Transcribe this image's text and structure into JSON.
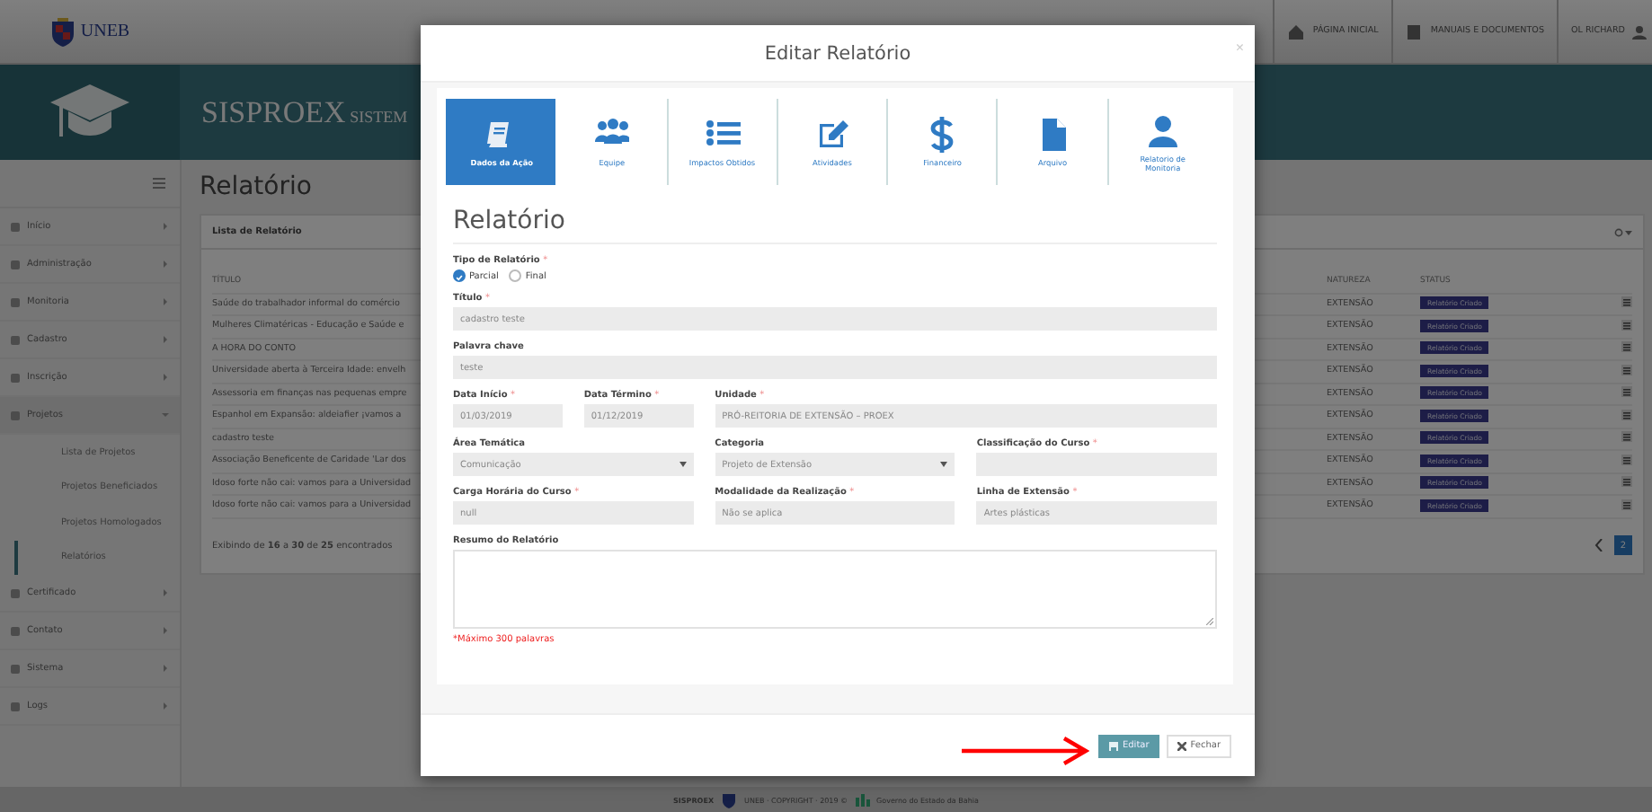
{
  "header": {
    "logo": "UNEB",
    "links": [
      {
        "kind": "home",
        "label": "PÁGINA INICIAL"
      },
      {
        "kind": "docs",
        "label": "MANUAIS E DOCUMENTOS"
      }
    ],
    "user": "OL RICHARD"
  },
  "banner": {
    "title": "SISPROEX",
    "subtitle": "SISTEM"
  },
  "sidebar": {
    "items": [
      {
        "label": "Início",
        "expanded": false
      },
      {
        "label": "Administração",
        "expanded": false
      },
      {
        "label": "Monitoria",
        "expanded": false
      },
      {
        "label": "Cadastro",
        "expanded": false
      },
      {
        "label": "Inscrição",
        "expanded": false
      },
      {
        "label": "Projetos",
        "expanded": true,
        "children": [
          {
            "label": "Lista de Projetos",
            "active": false
          },
          {
            "label": "Projetos Beneficiados",
            "active": false
          },
          {
            "label": "Projetos Homologados",
            "active": false
          },
          {
            "label": "Relatórios",
            "active": true
          }
        ]
      },
      {
        "label": "Certificado",
        "expanded": false
      },
      {
        "label": "Contato",
        "expanded": false
      },
      {
        "label": "Sistema",
        "expanded": false
      },
      {
        "label": "Logs",
        "expanded": false
      }
    ]
  },
  "page": {
    "title": "Relatório",
    "panel_title": "Lista de Relatório",
    "table": {
      "columns": [
        "TÍTULO",
        "NATUREZA",
        "STATUS"
      ],
      "rows": [
        {
          "title": "Saúde do trabalhador informal do comércio",
          "nature": "EXTENSÃO",
          "status": "Relatório Criado"
        },
        {
          "title": "Mulheres Climatéricas - Educação e Saúde e",
          "nature": "EXTENSÃO",
          "status": "Relatório Criado"
        },
        {
          "title": "A HORA DO CONTO",
          "nature": "EXTENSÃO",
          "status": "Relatório Criado"
        },
        {
          "title": "Universidade aberta à Terceira Idade: envelh",
          "nature": "EXTENSÃO",
          "status": "Relatório Criado"
        },
        {
          "title": "Assessoria em finanças nas pequenas empre",
          "nature": "EXTENSÃO",
          "status": "Relatório Criado"
        },
        {
          "title": "Espanhol em Expansão: aldeiafier ¡vamos a",
          "nature": "EXTENSÃO",
          "status": "Relatório Criado"
        },
        {
          "title": "cadastro teste",
          "nature": "EXTENSÃO",
          "status": "Relatório Criado"
        },
        {
          "title": "Associação Beneficente de Caridade 'Lar dos",
          "nature": "EXTENSÃO",
          "status": "Relatório Criado"
        },
        {
          "title": "Idoso forte não cai: vamos para a Universidad",
          "nature": "EXTENSÃO",
          "status": "Relatório Criado"
        },
        {
          "title": "Idoso forte não cai: vamos para a Universidad",
          "nature": "EXTENSÃO",
          "status": "Relatório Criado"
        }
      ]
    },
    "summary": "Exibindo de **16** a **30** de **25** encontrados",
    "pages": [
      {
        "label": "2",
        "selected": true
      }
    ]
  },
  "footer": {
    "brand": "SISPROEX",
    "org": "UNEB · COPYRIGHT · 2019 ©",
    "partner": "Governo do Estado da Bahia"
  },
  "modal": {
    "title": "Editar Relatório",
    "close": "×",
    "tabs": [
      {
        "kind": "book",
        "label": "Dados da Ação",
        "selected": true
      },
      {
        "kind": "team",
        "label": "Equipe",
        "selected": false
      },
      {
        "kind": "list",
        "label": "Impactos Obtidos",
        "selected": false
      },
      {
        "kind": "edit",
        "label": "Atividades",
        "selected": false
      },
      {
        "kind": "money",
        "label": "Financeiro",
        "selected": false
      },
      {
        "kind": "file",
        "label": "Arquivo",
        "selected": false
      },
      {
        "kind": "user",
        "label": "Relatorio de Monitoria",
        "selected": false
      }
    ],
    "heading": "Relatório",
    "report_type": {
      "label": "Tipo de Relatório",
      "mark": "*",
      "options": [
        {
          "label": "Parcial",
          "selected": true
        },
        {
          "label": "Final",
          "selected": false
        }
      ]
    },
    "rows": [
      [
        {
          "kind": "input",
          "label": "Título",
          "mark": "*",
          "value": "cadastro teste"
        }
      ],
      [
        {
          "kind": "input",
          "label": "Palavra chave",
          "value": "teste"
        }
      ],
      [
        {
          "kind": "pair",
          "fields": [
            {
              "kind": "date",
              "label": "Data Início",
              "mark": "*",
              "value": "01/03/2019"
            },
            {
              "kind": "date",
              "label": "Data Término",
              "mark": "*",
              "value": "01/12/2019"
            }
          ]
        },
        {
          "kind": "input",
          "label": "Unidade",
          "mark": "*",
          "value": "PRÓ-REITORIA DE EXTENSÃO – PROEX"
        }
      ],
      [
        {
          "kind": "select",
          "label": "Área Temática",
          "value": "Comunicação"
        },
        {
          "kind": "select",
          "label": "Categoria",
          "value": "Projeto de Extensão"
        },
        {
          "kind": "input",
          "label": "Classificação do Curso",
          "mark": "*"
        }
      ],
      [
        {
          "kind": "input",
          "label": "Carga Horária do Curso",
          "mark": "*",
          "value": "null"
        },
        {
          "kind": "input",
          "label": "Modalidade da Realização",
          "mark": "*",
          "value": "Não se aplica"
        },
        {
          "kind": "input",
          "label": "Linha de Extensão",
          "mark": "*",
          "value": "Artes plásticas"
        }
      ],
      [
        {
          "kind": "textarea",
          "label": "Resumo do Relatório"
        }
      ]
    ],
    "hint": "*Máximo 300 palavras",
    "buttons": [
      {
        "kind": "primary",
        "label": "Editar"
      },
      {
        "kind": "default",
        "label": "Fechar"
      }
    ]
  }
}
